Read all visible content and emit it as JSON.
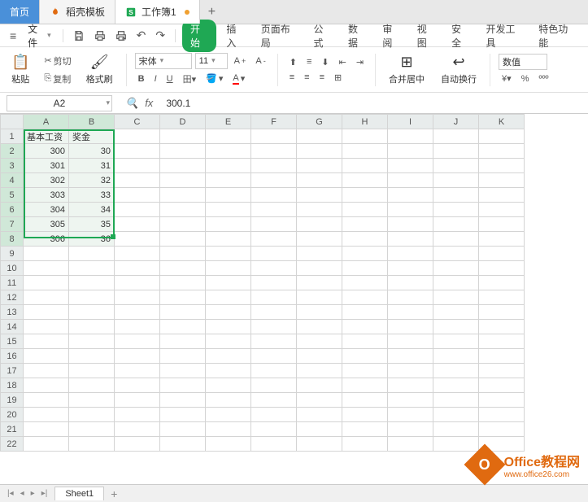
{
  "topTabs": {
    "home": "首页",
    "template": "稻壳模板",
    "workbook": "工作簿1"
  },
  "menu": {
    "file": "文件",
    "tabs": [
      "开始",
      "插入",
      "页面布局",
      "公式",
      "数据",
      "审阅",
      "视图",
      "安全",
      "开发工具",
      "特色功能"
    ]
  },
  "ribbon": {
    "paste": "粘贴",
    "cut": "剪切",
    "copy": "复制",
    "formatPainter": "格式刷",
    "fontName": "宋体",
    "fontSize": "11",
    "merge": "合并居中",
    "wrap": "自动换行",
    "numfmt": "数值"
  },
  "formulaBar": {
    "cellRef": "A2",
    "value": "300.1"
  },
  "grid": {
    "cols": [
      "A",
      "B",
      "C",
      "D",
      "E",
      "F",
      "G",
      "H",
      "I",
      "J",
      "K"
    ],
    "rows": 22,
    "headers": {
      "A": "基本工资",
      "B": "奖金"
    },
    "data": [
      {
        "A": "300",
        "B": "30"
      },
      {
        "A": "301",
        "B": "31"
      },
      {
        "A": "302",
        "B": "32"
      },
      {
        "A": "303",
        "B": "33"
      },
      {
        "A": "304",
        "B": "34"
      },
      {
        "A": "305",
        "B": "35"
      },
      {
        "A": "306",
        "B": "36"
      }
    ]
  },
  "sheetBar": {
    "sheet": "Sheet1"
  },
  "watermark": {
    "title": "Office教程网",
    "url": "www.office26.com"
  }
}
